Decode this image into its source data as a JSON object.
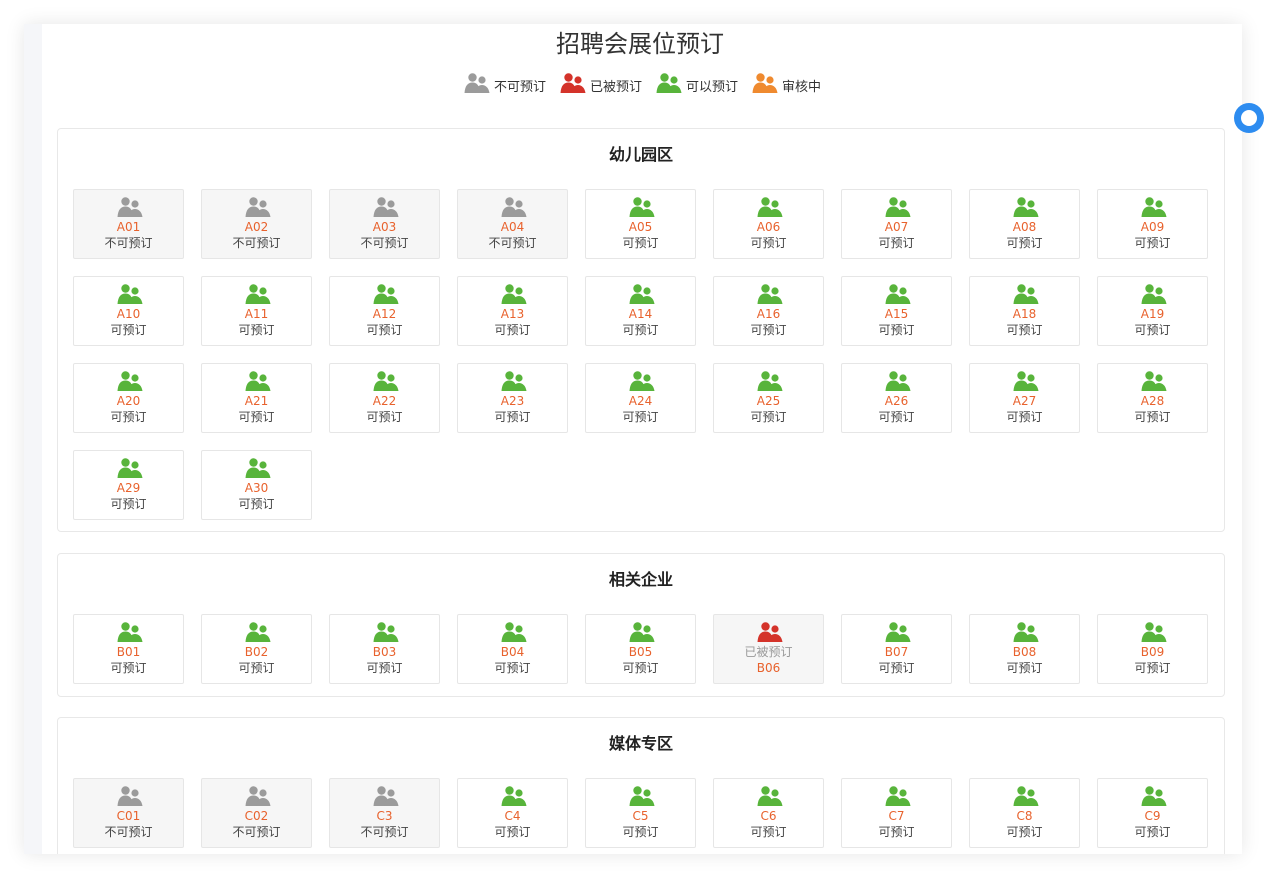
{
  "page": {
    "title": "招聘会展位预订"
  },
  "colors": {
    "unavailable": "#9b9b9b",
    "booked": "#d4332a",
    "available": "#58b43b",
    "pending": "#ef8a2f",
    "code": "#e8622d"
  },
  "legend": [
    {
      "label": "不可预订",
      "status": "unavailable",
      "icon": "people-icon"
    },
    {
      "label": "已被预订",
      "status": "booked",
      "icon": "people-icon"
    },
    {
      "label": "可以预订",
      "status": "available",
      "icon": "people-icon"
    },
    {
      "label": "审核中",
      "status": "pending",
      "icon": "people-icon"
    }
  ],
  "sections": [
    {
      "name": "幼儿园区",
      "booths": [
        {
          "code": "A01",
          "status": "unavailable",
          "status_label": "不可预订"
        },
        {
          "code": "A02",
          "status": "unavailable",
          "status_label": "不可预订"
        },
        {
          "code": "A03",
          "status": "unavailable",
          "status_label": "不可预订"
        },
        {
          "code": "A04",
          "status": "unavailable",
          "status_label": "不可预订"
        },
        {
          "code": "A05",
          "status": "available",
          "status_label": "可预订"
        },
        {
          "code": "A06",
          "status": "available",
          "status_label": "可预订"
        },
        {
          "code": "A07",
          "status": "available",
          "status_label": "可预订"
        },
        {
          "code": "A08",
          "status": "available",
          "status_label": "可预订"
        },
        {
          "code": "A09",
          "status": "available",
          "status_label": "可预订"
        },
        {
          "code": "A10",
          "status": "available",
          "status_label": "可预订"
        },
        {
          "code": "A11",
          "status": "available",
          "status_label": "可预订"
        },
        {
          "code": "A12",
          "status": "available",
          "status_label": "可预订"
        },
        {
          "code": "A13",
          "status": "available",
          "status_label": "可预订"
        },
        {
          "code": "A14",
          "status": "available",
          "status_label": "可预订"
        },
        {
          "code": "A16",
          "status": "available",
          "status_label": "可预订"
        },
        {
          "code": "A15",
          "status": "available",
          "status_label": "可预订"
        },
        {
          "code": "A18",
          "status": "available",
          "status_label": "可预订"
        },
        {
          "code": "A19",
          "status": "available",
          "status_label": "可预订"
        },
        {
          "code": "A20",
          "status": "available",
          "status_label": "可预订"
        },
        {
          "code": "A21",
          "status": "available",
          "status_label": "可预订"
        },
        {
          "code": "A22",
          "status": "available",
          "status_label": "可预订"
        },
        {
          "code": "A23",
          "status": "available",
          "status_label": "可预订"
        },
        {
          "code": "A24",
          "status": "available",
          "status_label": "可预订"
        },
        {
          "code": "A25",
          "status": "available",
          "status_label": "可预订"
        },
        {
          "code": "A26",
          "status": "available",
          "status_label": "可预订"
        },
        {
          "code": "A27",
          "status": "available",
          "status_label": "可预订"
        },
        {
          "code": "A28",
          "status": "available",
          "status_label": "可预订"
        },
        {
          "code": "A29",
          "status": "available",
          "status_label": "可预订"
        },
        {
          "code": "A30",
          "status": "available",
          "status_label": "可预订"
        }
      ]
    },
    {
      "name": "相关企业",
      "booths": [
        {
          "code": "B01",
          "status": "available",
          "status_label": "可预订"
        },
        {
          "code": "B02",
          "status": "available",
          "status_label": "可预订"
        },
        {
          "code": "B03",
          "status": "available",
          "status_label": "可预订"
        },
        {
          "code": "B04",
          "status": "available",
          "status_label": "可预订"
        },
        {
          "code": "B05",
          "status": "available",
          "status_label": "可预订"
        },
        {
          "code": "B06",
          "status": "booked",
          "status_label": "已被预订"
        },
        {
          "code": "B07",
          "status": "available",
          "status_label": "可预订"
        },
        {
          "code": "B08",
          "status": "available",
          "status_label": "可预订"
        },
        {
          "code": "B09",
          "status": "available",
          "status_label": "可预订"
        }
      ]
    },
    {
      "name": "媒体专区",
      "booths": [
        {
          "code": "C01",
          "status": "unavailable",
          "status_label": "不可预订"
        },
        {
          "code": "C02",
          "status": "unavailable",
          "status_label": "不可预订"
        },
        {
          "code": "C3",
          "status": "unavailable",
          "status_label": "不可预订"
        },
        {
          "code": "C4",
          "status": "available",
          "status_label": "可预订"
        },
        {
          "code": "C5",
          "status": "available",
          "status_label": "可预订"
        },
        {
          "code": "C6",
          "status": "available",
          "status_label": "可预订"
        },
        {
          "code": "C7",
          "status": "available",
          "status_label": "可预订"
        },
        {
          "code": "C8",
          "status": "available",
          "status_label": "可预订"
        },
        {
          "code": "C9",
          "status": "available",
          "status_label": "可预订"
        }
      ]
    }
  ]
}
